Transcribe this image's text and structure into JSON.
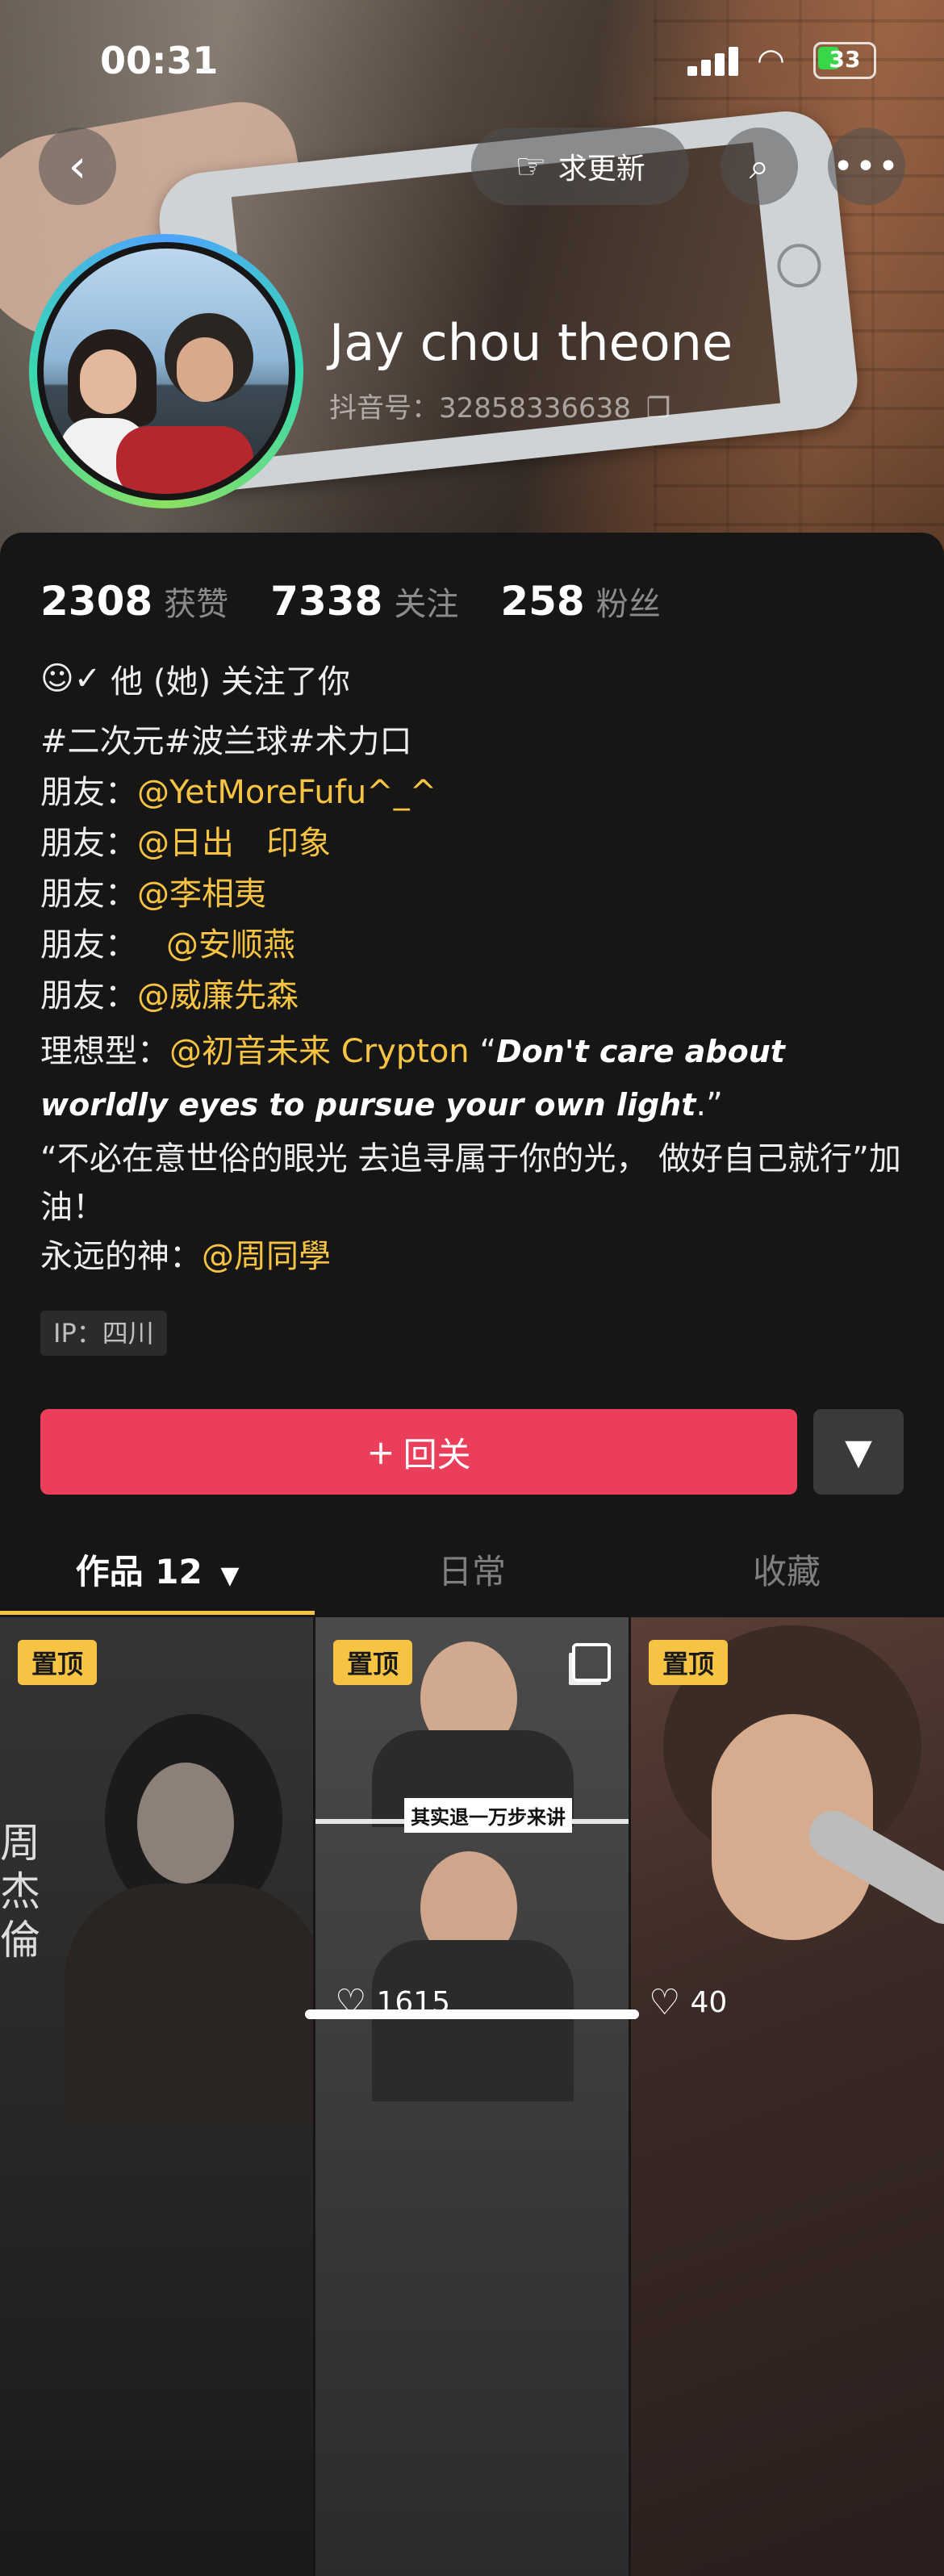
{
  "status": {
    "time": "00:31",
    "battery": "33"
  },
  "header": {
    "request_update_label": "求更新",
    "name": "Jay chou theone",
    "douyin_id": "抖音号：32858336638"
  },
  "stats": {
    "likes_num": "2308",
    "likes_label": "获赞",
    "following_num": "7338",
    "following_label": "关注",
    "followers_num": "258",
    "followers_label": "粉丝"
  },
  "follows_you": "他 (她) 关注了你",
  "bio": {
    "tags": "#二次元#波兰球#术力口",
    "friend_label": "朋友：",
    "friends": [
      "@YetMoreFufu^_^",
      "@日出　印象",
      "@李相夷",
      "@安顺燕",
      "@威廉先森"
    ],
    "ideal_label": "理想型：",
    "ideal_mention": "@初音未来 Crypton",
    "quote_open": "“",
    "quote_en": "Don't care about worldly eyes to pursue your own light",
    "quote_close": ".”",
    "quote_cn": "“不必在意世俗的眼光 去追寻属于你的光，  做好自己就行”加油！",
    "god_label": "永远的神：",
    "god_mention": "@周同學"
  },
  "ip": "IP：四川",
  "actions": {
    "follow_back": "回关"
  },
  "tabs": {
    "works": "作品 12",
    "daily": "日常",
    "favorites": "收藏"
  },
  "videos": [
    {
      "pinned": "置顶",
      "overlay_text": "周杰倫",
      "likes": ""
    },
    {
      "pinned": "置顶",
      "subtitle": "其实退一万步来讲",
      "likes": "1615"
    },
    {
      "pinned": "置顶",
      "likes": "40"
    }
  ],
  "icons": {
    "back": "chevron-left-icon",
    "search": "search-icon",
    "more": "more-icon",
    "hand": "hand-point-icon",
    "copy": "copy-icon",
    "user_check": "user-check-icon",
    "share": "send-icon",
    "heart": "heart-icon"
  },
  "colors": {
    "accent": "#f6c343",
    "follow_button": "#ea3e5a",
    "background": "#161616"
  }
}
